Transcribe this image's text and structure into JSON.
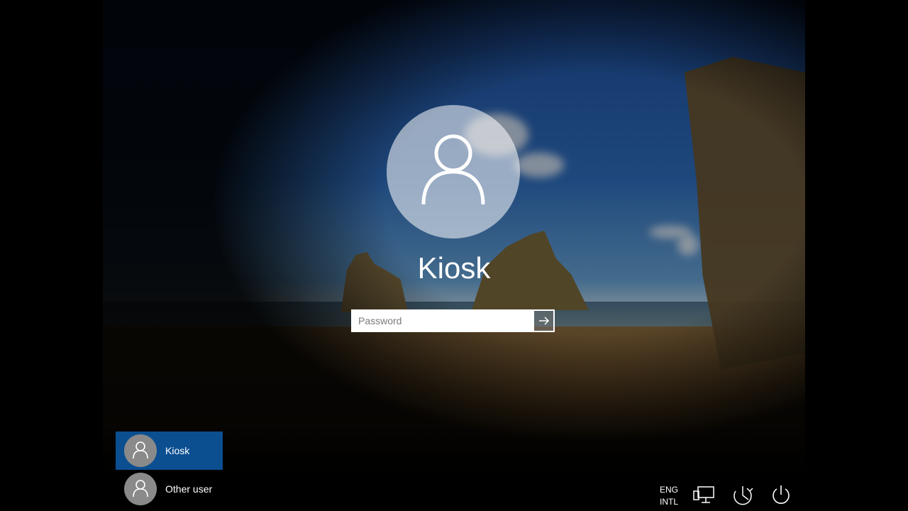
{
  "login": {
    "username": "Kiosk",
    "password_placeholder": "Password"
  },
  "users": [
    {
      "label": "Kiosk",
      "selected": true
    },
    {
      "label": "Other user",
      "selected": false
    }
  ],
  "system": {
    "lang_line1": "ENG",
    "lang_line2": "INTL",
    "icons": [
      "network-icon",
      "ease-of-access-icon",
      "power-icon"
    ]
  },
  "colors": {
    "selected_user_bg": "#0b4f91",
    "text": "#ffffff"
  }
}
